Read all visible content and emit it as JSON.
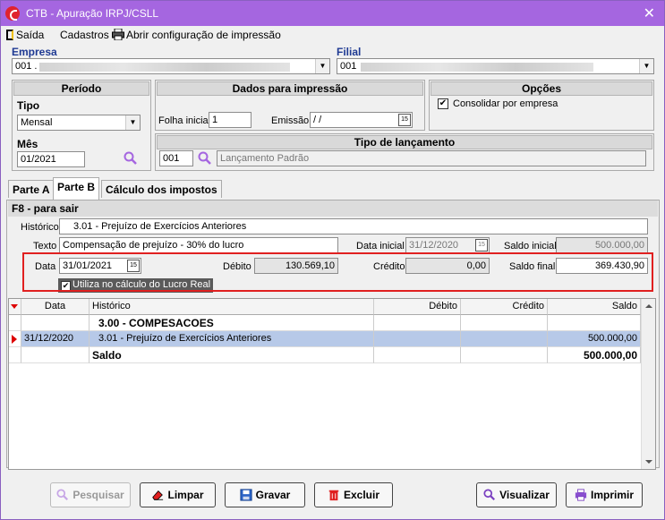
{
  "window": {
    "title": "CTB - Apuração IRPJ/CSLL",
    "close_glyph": "✕"
  },
  "menu": {
    "exit_label": "Saída",
    "cadastros_label": "Cadastros",
    "print_config_label": "Abrir configuração de impressão"
  },
  "empresa": {
    "label": "Empresa",
    "value": "001 ."
  },
  "filial": {
    "label": "Filial",
    "value": "001"
  },
  "periodo": {
    "header": "Período",
    "tipo_label": "Tipo",
    "tipo_value": "Mensal",
    "mes_label": "Mês",
    "mes_value": "01/2021"
  },
  "dados_impressao": {
    "header": "Dados para impressão",
    "folha_label": "Folha inicial",
    "folha_value": "1",
    "emissao_label": "Emissão",
    "emissao_value": " / /"
  },
  "opcoes": {
    "header": "Opções",
    "consolidar_label": "Consolidar por empresa",
    "consolidar_checked": true
  },
  "tipo_lancamento": {
    "header": "Tipo de lançamento",
    "code": "001",
    "description": "Lançamento Padrão"
  },
  "tabs": [
    "Parte A",
    "Parte B",
    "Cálculo dos impostos"
  ],
  "active_tab": "Parte B",
  "form": {
    "f8_label": "F8 - para sair",
    "historico_label": "Histórico",
    "historico_value": "3.01 - Prejuízo de Exercícios Anteriores",
    "texto_label": "Texto",
    "texto_value": "Compensação de prejuízo - 30% do lucro",
    "data_inicial_label": "Data inicial",
    "data_inicial_value": "31/12/2020",
    "saldo_inicial_label": "Saldo inicial",
    "saldo_inicial_value": "500.000,00",
    "data_label": "Data",
    "data_value": "31/01/2021",
    "debito_label": "Débito",
    "debito_value": "130.569,10",
    "credito_label": "Crédito",
    "credito_value": "0,00",
    "saldo_final_label": "Saldo final",
    "saldo_final_value": "369.430,90",
    "lucro_real_label": "Utiliza no cálculo do Lucro Real",
    "lucro_real_checked": true,
    "cal_glyph": "15"
  },
  "grid": {
    "columns": [
      "Data",
      "Histórico",
      "Débito",
      "Crédito",
      "Saldo"
    ],
    "rows": [
      {
        "data": "",
        "historico": "3.00 - COMPESACOES",
        "debito": "",
        "credito": "",
        "saldo": ""
      },
      {
        "data": "31/12/2020",
        "historico": "3.01 - Prejuízo de Exercícios Anteriores",
        "debito": "",
        "credito": "",
        "saldo": "500.000,00"
      },
      {
        "data": "",
        "historico": "Saldo",
        "debito": "",
        "credito": "",
        "saldo": "500.000,00"
      }
    ]
  },
  "buttons": {
    "pesquisar": "Pesquisar",
    "limpar": "Limpar",
    "gravar": "Gravar",
    "excluir": "Excluir",
    "visualizar": "Visualizar",
    "imprimir": "Imprimir"
  },
  "colors": {
    "titlebar": "#a566e0",
    "highlight_red": "#e02020",
    "selected_row": "#b7c9e8",
    "label_blue": "#1f3a93"
  }
}
